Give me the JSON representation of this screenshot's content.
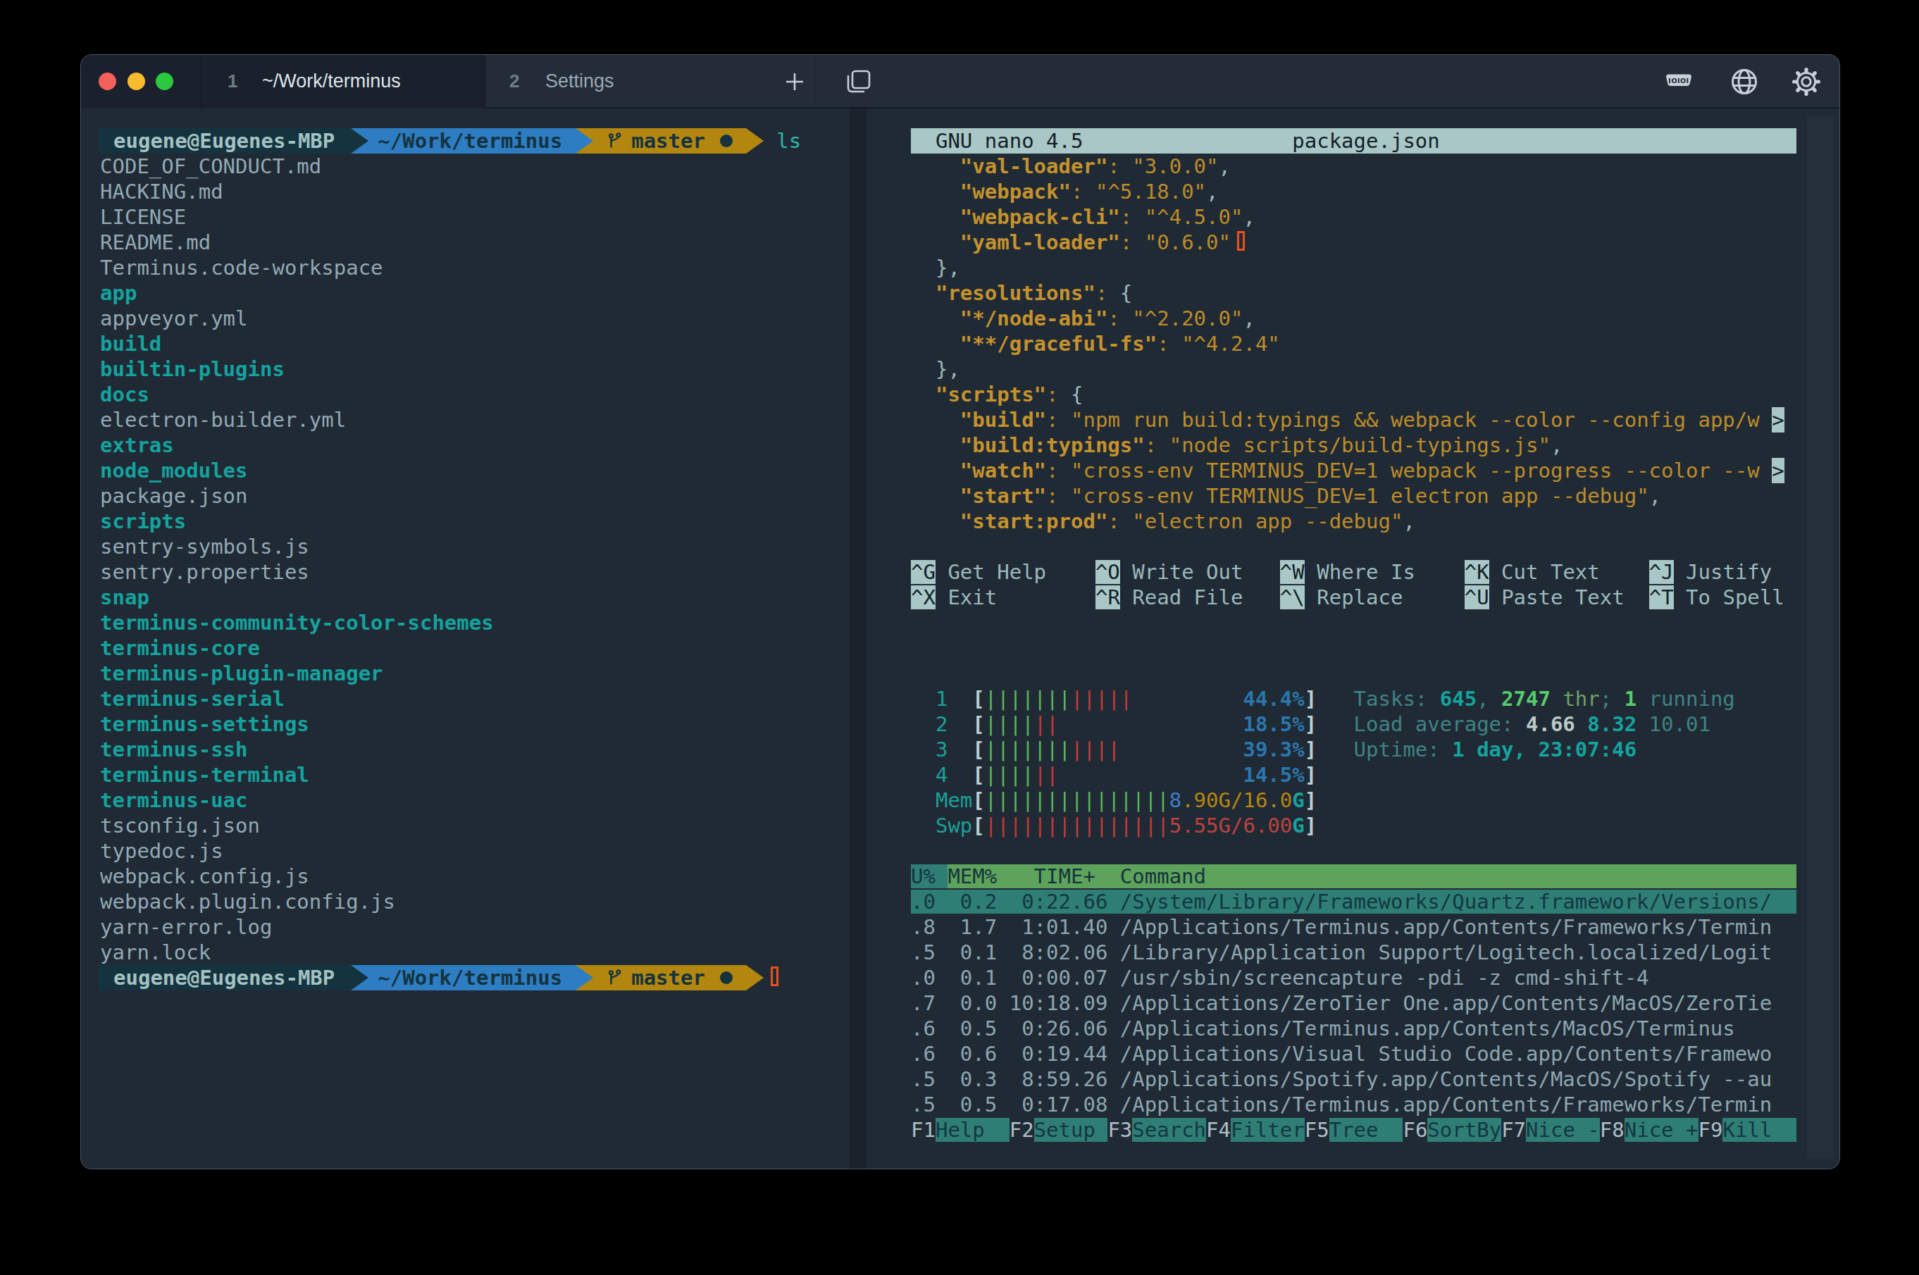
{
  "titlebar": {
    "tabs": [
      {
        "number": "1",
        "title": "~/Work/terminus",
        "active": true
      },
      {
        "number": "2",
        "title": "Settings",
        "active": false
      }
    ],
    "icons": {
      "serial_label": "IOIOI"
    }
  },
  "left_terminal": {
    "prompt": {
      "user_host": "eugene@Eugenes-MBP",
      "path": "~/Work/terminus",
      "branch": "master",
      "command": "ls"
    },
    "files": [
      {
        "name": "CODE_OF_CONDUCT.md",
        "dir": false
      },
      {
        "name": "HACKING.md",
        "dir": false
      },
      {
        "name": "LICENSE",
        "dir": false
      },
      {
        "name": "README.md",
        "dir": false
      },
      {
        "name": "Terminus.code-workspace",
        "dir": false
      },
      {
        "name": "app",
        "dir": true
      },
      {
        "name": "appveyor.yml",
        "dir": false
      },
      {
        "name": "build",
        "dir": true
      },
      {
        "name": "builtin-plugins",
        "dir": true
      },
      {
        "name": "docs",
        "dir": true
      },
      {
        "name": "electron-builder.yml",
        "dir": false
      },
      {
        "name": "extras",
        "dir": true
      },
      {
        "name": "node_modules",
        "dir": true
      },
      {
        "name": "package.json",
        "dir": false
      },
      {
        "name": "scripts",
        "dir": true
      },
      {
        "name": "sentry-symbols.js",
        "dir": false
      },
      {
        "name": "sentry.properties",
        "dir": false
      },
      {
        "name": "snap",
        "dir": true
      },
      {
        "name": "terminus-community-color-schemes",
        "dir": true
      },
      {
        "name": "terminus-core",
        "dir": true
      },
      {
        "name": "terminus-plugin-manager",
        "dir": true
      },
      {
        "name": "terminus-serial",
        "dir": true
      },
      {
        "name": "terminus-settings",
        "dir": true
      },
      {
        "name": "terminus-ssh",
        "dir": true
      },
      {
        "name": "terminus-terminal",
        "dir": true
      },
      {
        "name": "terminus-uac",
        "dir": true
      },
      {
        "name": "tsconfig.json",
        "dir": false
      },
      {
        "name": "typedoc.js",
        "dir": false
      },
      {
        "name": "webpack.config.js",
        "dir": false
      },
      {
        "name": "webpack.plugin.config.js",
        "dir": false
      },
      {
        "name": "yarn-error.log",
        "dir": false
      },
      {
        "name": "yarn.lock",
        "dir": false
      }
    ]
  },
  "nano": {
    "version": "GNU nano 4.5",
    "filename": "package.json",
    "lines": [
      [
        [
          "    ",
          "np"
        ],
        [
          "\"val-loader\"",
          "nk"
        ],
        [
          ":",
          "nv"
        ],
        [
          " ",
          "np"
        ],
        [
          "\"3.0.0\"",
          "nv"
        ],
        [
          ",",
          "np"
        ]
      ],
      [
        [
          "    ",
          "np"
        ],
        [
          "\"webpack\"",
          "nk"
        ],
        [
          ":",
          "nv"
        ],
        [
          " ",
          "np"
        ],
        [
          "\"^5.18.0\"",
          "nv"
        ],
        [
          ",",
          "np"
        ]
      ],
      [
        [
          "    ",
          "np"
        ],
        [
          "\"webpack-cli\"",
          "nk"
        ],
        [
          ":",
          "nv"
        ],
        [
          " ",
          "np"
        ],
        [
          "\"^4.5.0\"",
          "nv"
        ],
        [
          ",",
          "np"
        ]
      ],
      [
        [
          "    ",
          "np"
        ],
        [
          "\"yaml-loader\"",
          "nk"
        ],
        [
          ":",
          "nv"
        ],
        [
          " ",
          "np"
        ],
        [
          "\"0.6.0\"",
          "nv"
        ]
      ],
      [
        [
          "  },",
          "np"
        ]
      ],
      [
        [
          "  ",
          "np"
        ],
        [
          "\"resolutions\"",
          "nk"
        ],
        [
          ":",
          "nv"
        ],
        [
          " ",
          "np"
        ],
        [
          "{",
          "np"
        ]
      ],
      [
        [
          "    ",
          "np"
        ],
        [
          "\"*/node-abi\"",
          "nk"
        ],
        [
          ":",
          "nv"
        ],
        [
          " ",
          "np"
        ],
        [
          "\"^2.20.0\"",
          "nv"
        ],
        [
          ",",
          "np"
        ]
      ],
      [
        [
          "    ",
          "np"
        ],
        [
          "\"**/graceful-fs\"",
          "nk"
        ],
        [
          ":",
          "nv"
        ],
        [
          " ",
          "np"
        ],
        [
          "\"^4.2.4\"",
          "nv"
        ]
      ],
      [
        [
          "  },",
          "np"
        ]
      ],
      [
        [
          "  ",
          "np"
        ],
        [
          "\"scripts\"",
          "nk"
        ],
        [
          ":",
          "nv"
        ],
        [
          " ",
          "np"
        ],
        [
          "{",
          "np"
        ]
      ],
      [
        [
          "    ",
          "np"
        ],
        [
          "\"build\"",
          "nk"
        ],
        [
          ":",
          "nv"
        ],
        [
          " ",
          "np"
        ],
        [
          "\"npm run build:typings && webpack --color --config app/w",
          "nv"
        ]
      ],
      [
        [
          "    ",
          "np"
        ],
        [
          "\"build:typings\"",
          "nk"
        ],
        [
          ":",
          "nv"
        ],
        [
          " ",
          "np"
        ],
        [
          "\"node scripts/build-typings.js\"",
          "nv"
        ],
        [
          ",",
          "np"
        ]
      ],
      [
        [
          "    ",
          "np"
        ],
        [
          "\"watch\"",
          "nk"
        ],
        [
          ":",
          "nv"
        ],
        [
          " ",
          "np"
        ],
        [
          "\"cross-env TERMINUS_DEV=1 webpack --progress --color --w",
          "nv"
        ]
      ],
      [
        [
          "    ",
          "np"
        ],
        [
          "\"start\"",
          "nk"
        ],
        [
          ":",
          "nv"
        ],
        [
          " ",
          "np"
        ],
        [
          "\"cross-env TERMINUS_DEV=1 electron app --debug\"",
          "nv"
        ],
        [
          ",",
          "np"
        ]
      ],
      [
        [
          "    ",
          "np"
        ],
        [
          "\"start:prod\"",
          "nk"
        ],
        [
          ":",
          "nv"
        ],
        [
          " ",
          "np"
        ],
        [
          "\"electron app --debug\"",
          "nv"
        ],
        [
          ",",
          "np"
        ]
      ]
    ],
    "continuation_rows": [
      10,
      12
    ],
    "cursor": {
      "row": 3,
      "col": 26
    },
    "shortcuts": [
      [
        [
          "^G",
          "Get Help"
        ],
        [
          "^O",
          "Write Out"
        ],
        [
          "^W",
          "Where Is"
        ],
        [
          "^K",
          "Cut Text"
        ],
        [
          "^J",
          "Justify"
        ]
      ],
      [
        [
          "^X",
          "Exit"
        ],
        [
          "^R",
          "Read File"
        ],
        [
          "^\\",
          "Replace"
        ],
        [
          "^U",
          "Paste Text"
        ],
        [
          "^T",
          "To Spell"
        ]
      ]
    ]
  },
  "htop": {
    "meters": [
      {
        "label": "1",
        "green": 7,
        "red": 5,
        "text": [
          [
            "44.4%",
            "h-pct"
          ]
        ]
      },
      {
        "label": "2",
        "green": 4,
        "red": 2,
        "text": [
          [
            "18.5%",
            "h-pct"
          ]
        ]
      },
      {
        "label": "3",
        "green": 7,
        "red": 4,
        "text": [
          [
            "39.3%",
            "h-pct"
          ]
        ]
      },
      {
        "label": "4",
        "green": 4,
        "red": 2,
        "text": [
          [
            "14.5%",
            "h-pct"
          ]
        ]
      },
      {
        "label": "Mem",
        "green": 15,
        "red": 0,
        "text": [
          [
            "8",
            "h-blue"
          ],
          [
            ".90G/16.0",
            "h-gold"
          ],
          [
            "G",
            "h-tealb"
          ]
        ]
      },
      {
        "label": "Swp",
        "green": 0,
        "red": 15,
        "text": [
          [
            "5.55G/6.00",
            "h-redt"
          ],
          [
            "G",
            "h-tealb"
          ]
        ]
      }
    ],
    "info": [
      [
        [
          "Tasks: ",
          "h-dim"
        ],
        [
          "645",
          "h-tealb"
        ],
        [
          ", ",
          "h-dim"
        ],
        [
          "2747",
          "h-greenb"
        ],
        [
          " thr",
          "h-olive"
        ],
        [
          "; ",
          "h-dim"
        ],
        [
          "1",
          "h-greenb"
        ],
        [
          " running",
          "h-dim"
        ]
      ],
      [
        [
          "Load average: ",
          "h-dim"
        ],
        [
          "4.66 ",
          "h-whiteb"
        ],
        [
          "8.32 ",
          "h-tealb"
        ],
        [
          "10.01",
          "h-dim"
        ]
      ],
      [
        [
          "Uptime: ",
          "h-dim"
        ],
        [
          "1 day, 23:07:46",
          "h-tealb"
        ]
      ]
    ],
    "table": {
      "sort_header": "U% ",
      "header_rest": "MEM%   TIME+  Command",
      "rows": [
        ".0  0.2  0:22.66 /System/Library/Frameworks/Quartz.framework/Versions/",
        ".8  1.7  1:01.40 /Applications/Terminus.app/Contents/Frameworks/Termin",
        ".5  0.1  8:02.06 /Library/Application Support/Logitech.localized/Logit",
        ".0  0.1  0:00.07 /usr/sbin/screencapture -pdi -z cmd-shift-4",
        ".7  0.0 10:18.09 /Applications/ZeroTier One.app/Contents/MacOS/ZeroTie",
        ".6  0.5  0:26.06 /Applications/Terminus.app/Contents/MacOS/Terminus",
        ".6  0.6  0:19.44 /Applications/Visual Studio Code.app/Contents/Framewo",
        ".5  0.3  8:59.26 /Applications/Spotify.app/Contents/MacOS/Spotify --au",
        ".5  0.5  0:17.08 /Applications/Terminus.app/Contents/Frameworks/Termin"
      ],
      "selected_row": 0
    },
    "fkeys": [
      [
        "F1",
        "Help  "
      ],
      [
        "F2",
        "Setup "
      ],
      [
        "F3",
        "Search"
      ],
      [
        "F4",
        "Filter"
      ],
      [
        "F5",
        "Tree  "
      ],
      [
        "F6",
        "SortBy"
      ],
      [
        "F7",
        "Nice -"
      ],
      [
        "F8",
        "Nice +"
      ],
      [
        "F9",
        "Kill  "
      ]
    ]
  }
}
